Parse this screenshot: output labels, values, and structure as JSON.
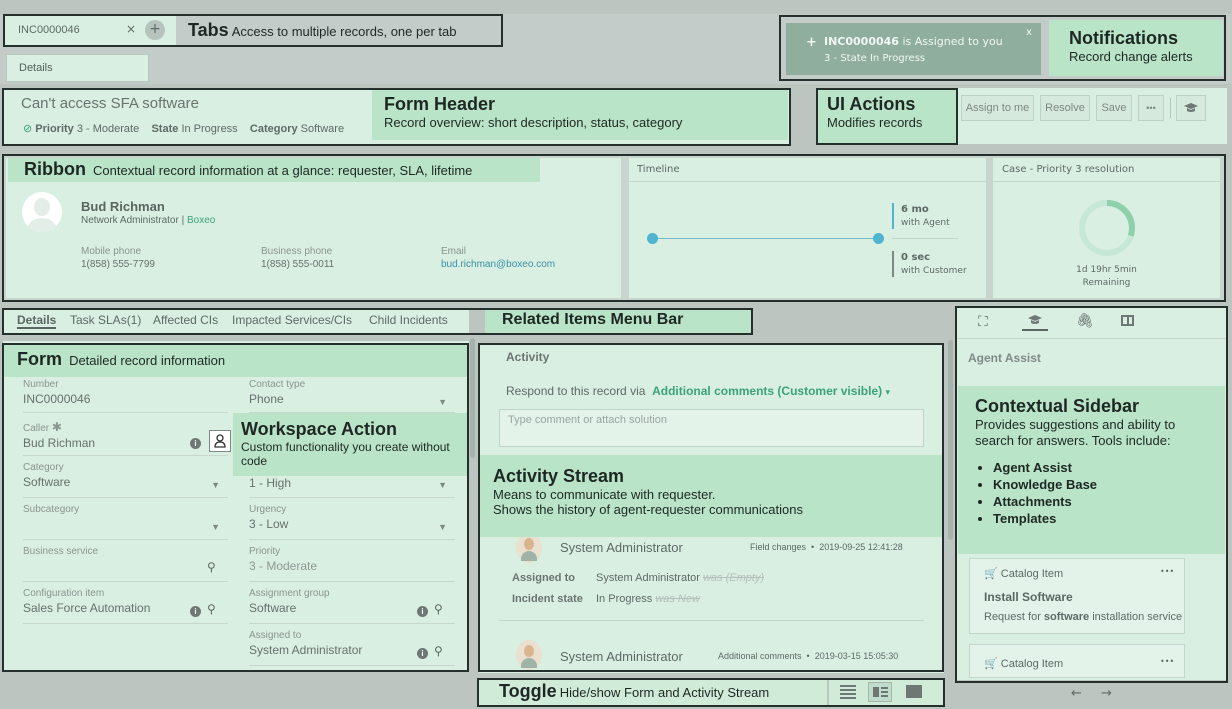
{
  "tabs": {
    "record_tab": "INC0000046",
    "close": "×",
    "add": "+",
    "details_tab": "Details"
  },
  "notification": {
    "plus": "+",
    "record": "INC0000046",
    "text": " is Assigned to you",
    "state": "3 - State In Progress",
    "close": "x"
  },
  "header": {
    "title": "Can't access SFA software",
    "priority_label": "Priority",
    "priority_value": "3 - Moderate",
    "state_label": "State",
    "state_value": "In Progress",
    "category_label": "Category",
    "category_value": "Software"
  },
  "ui_actions": {
    "assign": "Assign to me",
    "resolve": "Resolve",
    "save": "Save",
    "more": "•••"
  },
  "ribbon": {
    "name": "Bud Richman",
    "title": "Network Administrator",
    "company": "Boxeo",
    "mobile_label": "Mobile phone",
    "mobile": "1(858) 555-7799",
    "business_label": "Business phone",
    "business": "1(858) 555-0011",
    "email_label": "Email",
    "email": "bud.richman@boxeo.com",
    "timeline_title": "Timeline",
    "agent_time": "6 mo",
    "agent_label": "with Agent",
    "cust_time": "0 sec",
    "cust_label": "with Customer",
    "sla_title": "Case - Priority 3 resolution",
    "sla_remaining": "1d 19hr 5min",
    "sla_remaining_label": "Remaining",
    "sla_progress": 0.3
  },
  "related_tabs": [
    "Details",
    "Task SLAs(1)",
    "Affected CIs",
    "Impacted Services/CIs",
    "Child Incidents"
  ],
  "form": {
    "number_label": "Number",
    "number": "INC0000046",
    "contact_label": "Contact type",
    "contact": "Phone",
    "caller_label": "Caller",
    "caller_req": "✱",
    "caller": "Bud Richman",
    "category_label": "Category",
    "category": "Software",
    "impact": "1 - High",
    "subcategory_label": "Subcategory",
    "urgency_label": "Urgency",
    "urgency": "3 - Low",
    "business_service_label": "Business service",
    "priority_label": "Priority",
    "priority": "3 - Moderate",
    "ci_label": "Configuration item",
    "ci": "Sales Force Automation",
    "group_label": "Assignment group",
    "group": "Software",
    "assigned_label": "Assigned to",
    "assigned": "System Administrator"
  },
  "activity": {
    "title": "Activity",
    "respond_prefix": "Respond to this record via",
    "respond_link": "Additional comments (Customer visible)",
    "placeholder": "Type comment or attach solution",
    "entry1": {
      "author": "System Administrator",
      "type": "Field changes",
      "date": "2019-09-25 12:41:28",
      "f1_label": "Assigned to",
      "f1_value": "System Administrator",
      "f1_was": "was (Empty)",
      "f2_label": "Incident state",
      "f2_value": "In Progress",
      "f2_was": "was New"
    },
    "entry2": {
      "author": "System Administrator",
      "type": "Additional comments",
      "date": "2019-03-15 15:05:30"
    }
  },
  "sidebar": {
    "title": "Agent Assist",
    "card1": {
      "type": "Catalog Item",
      "more": "•••",
      "title": "Install Software",
      "desc_pre": "Request for ",
      "desc_bold": "software",
      "desc_post": " installation service"
    },
    "card2": {
      "type": "Catalog Item",
      "more": "•••"
    },
    "prev": "←",
    "next": "→"
  },
  "labels": {
    "tabs": {
      "t": "Tabs",
      "d": "Access to multiple records, one per tab"
    },
    "notifications": {
      "t": "Notifications",
      "d": "Record change alerts"
    },
    "form_header": {
      "t": "Form Header",
      "d": "Record overview: short description, status, category"
    },
    "ui_actions": {
      "t": "UI Actions",
      "d": "Modifies records"
    },
    "ribbon": {
      "t": "Ribbon",
      "d": "Contextual record information at a glance: requester, SLA, lifetime"
    },
    "related": {
      "t": "Related Items Menu Bar"
    },
    "form": {
      "t": "Form",
      "d": "Detailed record information"
    },
    "workspace": {
      "t": "Workspace Action",
      "d": "Custom functionality you create without code"
    },
    "activity": {
      "t": "Activity Stream",
      "d1": "Means to communicate with requester.",
      "d2": "Shows the history of agent-requester communications"
    },
    "sidebar": {
      "t": "Contextual Sidebar",
      "d": "Provides suggestions and ability to search for answers. Tools include:",
      "items": [
        "Agent Assist",
        "Knowledge Base",
        "Attachments",
        "Templates"
      ]
    },
    "toggle": {
      "t": "Toggle",
      "d": "Hide/show Form and Activity Stream"
    }
  },
  "colors": {
    "accent": "#3aa37a",
    "overlay": "#b9e4c7",
    "frame": "#25302c"
  }
}
